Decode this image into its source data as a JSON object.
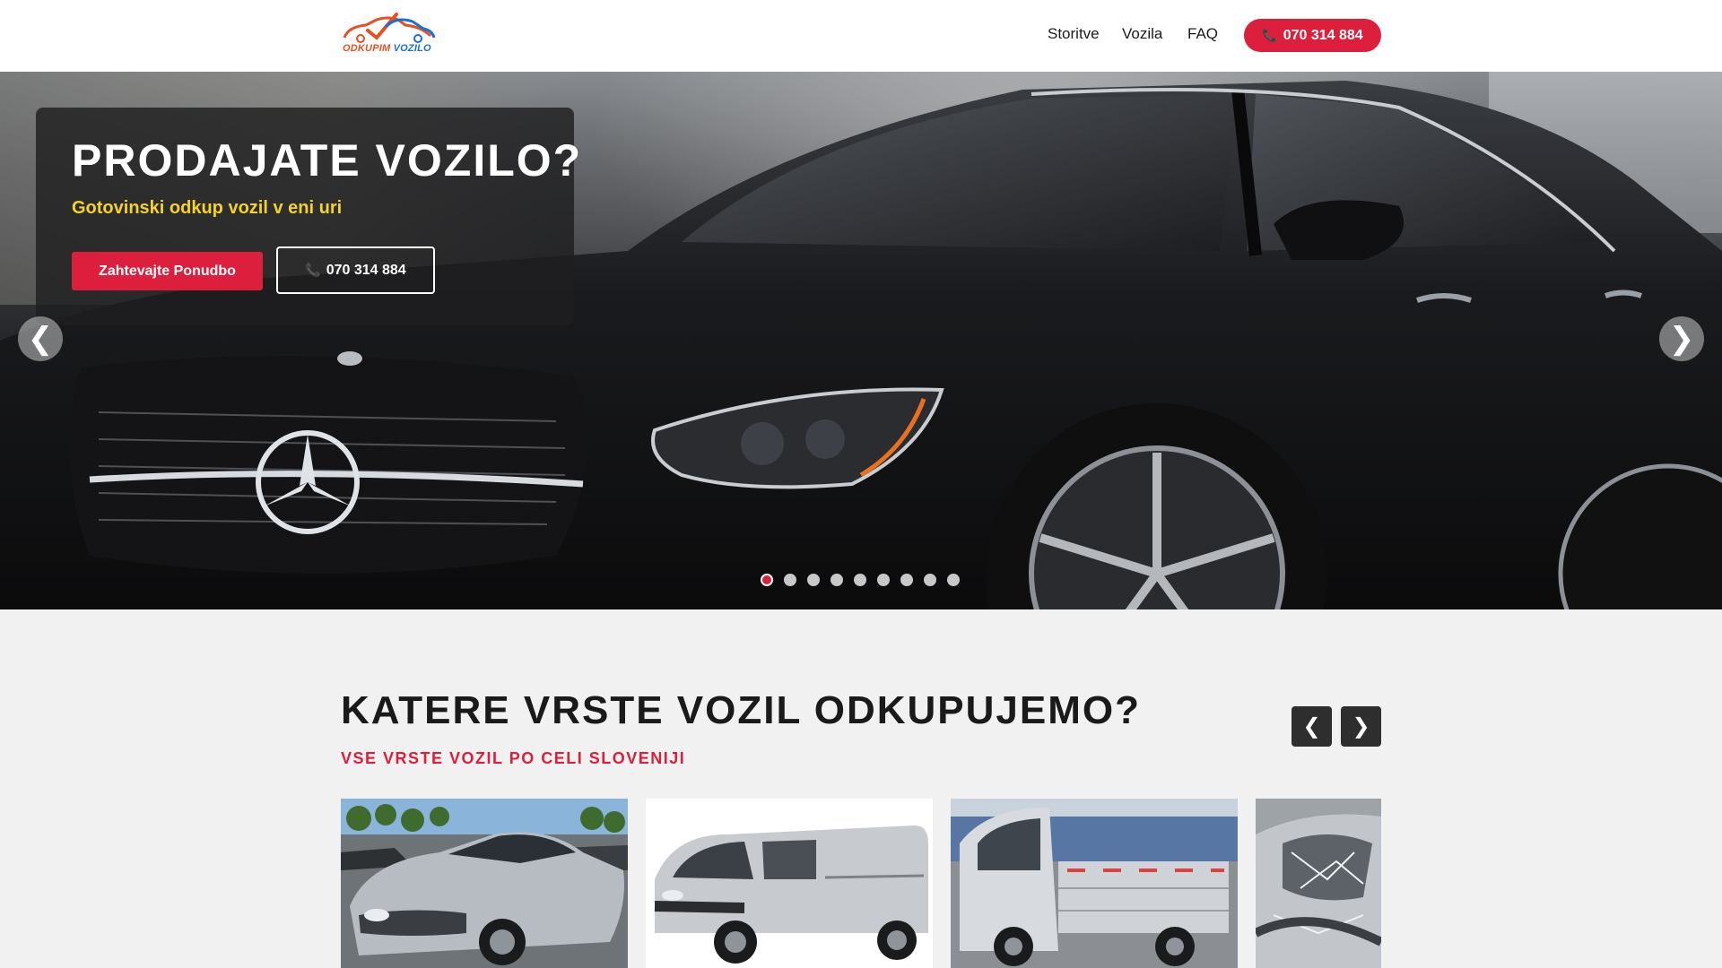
{
  "header": {
    "logo_line1": "ODKUPIM",
    "logo_line2": "VOZILO",
    "nav": [
      {
        "label": "Storitve"
      },
      {
        "label": "Vozila"
      },
      {
        "label": "FAQ"
      }
    ],
    "phone_label": "070 314 884",
    "phone_icon": "phone-icon"
  },
  "hero": {
    "title": "PRODAJATE VOZILO?",
    "subtitle": "Gotovinski odkup vozil v eni uri",
    "cta_label": "Zahtevajte Ponudbo",
    "phone_label": "070 314 884",
    "prev_arrow": "❮",
    "next_arrow": "❯",
    "slide_count": 9,
    "active_slide": 1
  },
  "section": {
    "title": "KATERE VRSTE VOZIL ODKUPUJEMO?",
    "subtitle": "VSE VRSTE VOZIL PO CELI SLOVENIJI",
    "prev_arrow": "❮",
    "next_arrow": "❯"
  },
  "colors": {
    "accent": "#dc1f3c",
    "hero_subtitle": "#f5d22a",
    "dark_button": "#2e2e2e"
  }
}
